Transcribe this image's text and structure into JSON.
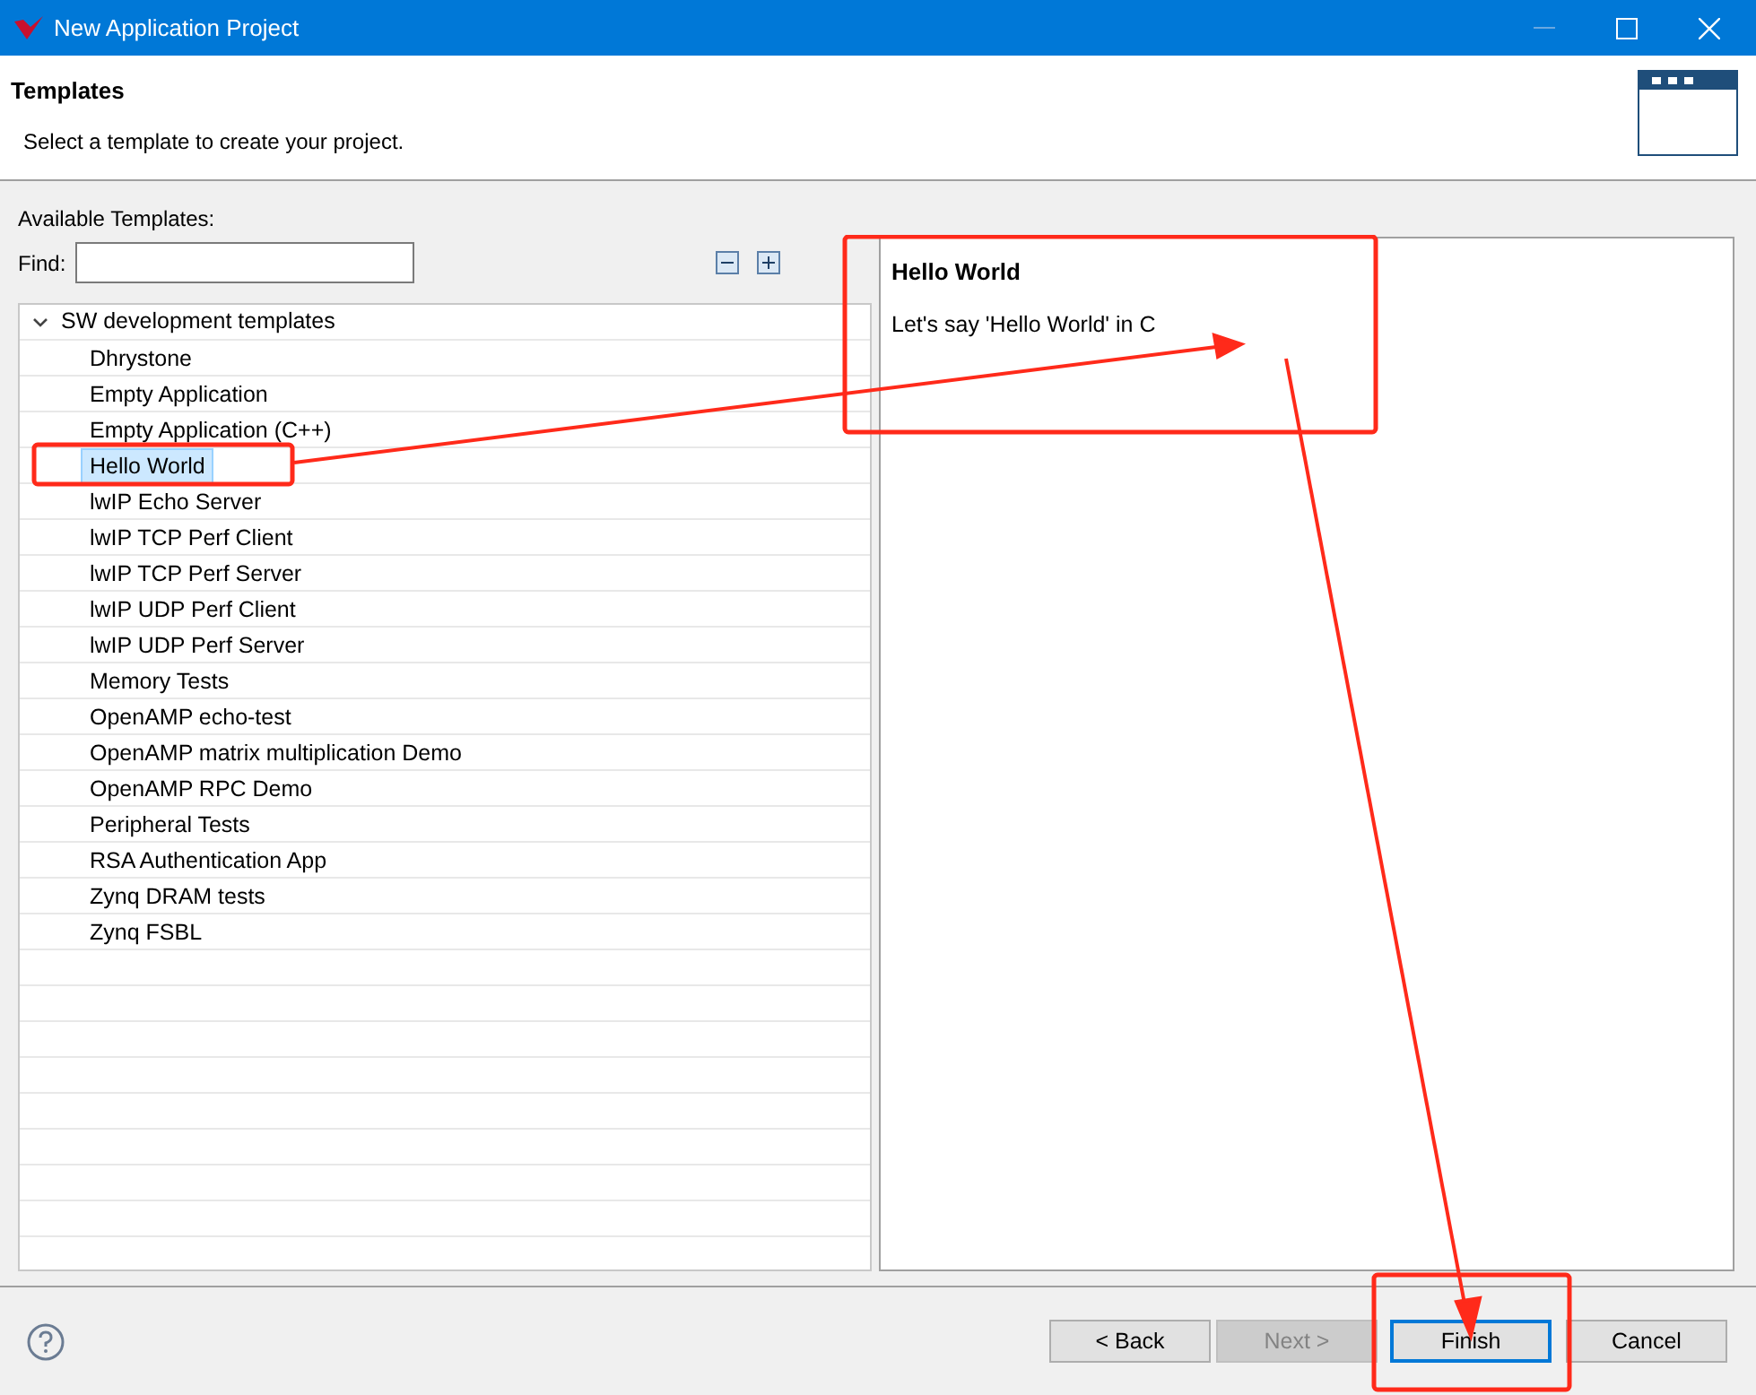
{
  "window": {
    "title": "New Application Project"
  },
  "header": {
    "title": "Templates",
    "description": "Select a template to create your project."
  },
  "templates": {
    "label": "Available Templates:",
    "find_label": "Find:",
    "tree": [
      {
        "label": "SW development templates",
        "expanded": true,
        "children": [
          {
            "label": "Dhrystone",
            "selected": false
          },
          {
            "label": "Empty Application",
            "selected": false
          },
          {
            "label": "Empty Application (C++)",
            "selected": false
          },
          {
            "label": "Hello World",
            "selected": true
          },
          {
            "label": "lwIP Echo Server",
            "selected": false
          },
          {
            "label": "lwIP TCP Perf Client",
            "selected": false
          },
          {
            "label": "lwIP TCP Perf Server",
            "selected": false
          },
          {
            "label": "lwIP UDP Perf Client",
            "selected": false
          },
          {
            "label": "lwIP UDP Perf Server",
            "selected": false
          },
          {
            "label": "Memory Tests",
            "selected": false
          },
          {
            "label": "OpenAMP echo-test",
            "selected": false
          },
          {
            "label": "OpenAMP matrix multiplication Demo",
            "selected": false
          },
          {
            "label": "OpenAMP RPC Demo",
            "selected": false
          },
          {
            "label": "Peripheral Tests",
            "selected": false
          },
          {
            "label": "RSA Authentication App",
            "selected": false
          },
          {
            "label": "Zynq DRAM tests",
            "selected": false
          },
          {
            "label": "Zynq FSBL",
            "selected": false
          }
        ]
      }
    ]
  },
  "description": {
    "title": "Hello World",
    "text": "Let's say 'Hello World' in C"
  },
  "buttons": [
    {
      "label": "< Back",
      "disabled": false,
      "default": false
    },
    {
      "label": "Next >",
      "disabled": true,
      "default": false
    },
    {
      "label": "Finish",
      "disabled": false,
      "default": true
    },
    {
      "label": "Cancel",
      "disabled": false,
      "default": false
    }
  ]
}
